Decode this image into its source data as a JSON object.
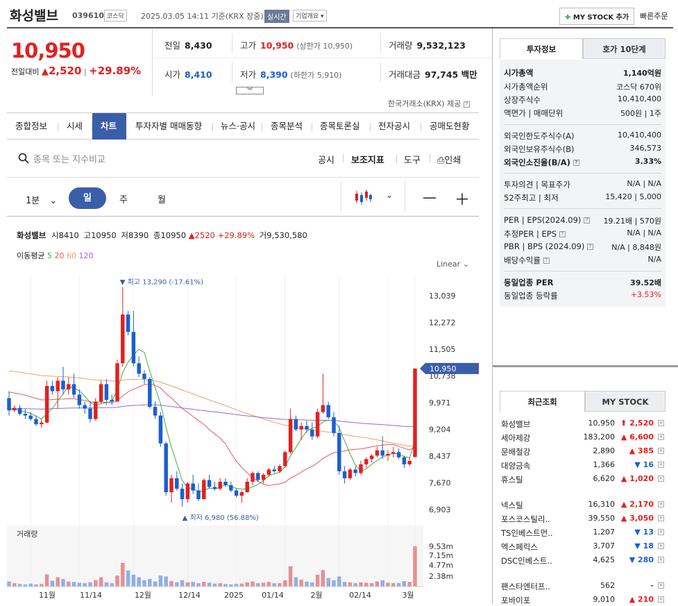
{
  "header": {
    "stock_name": "화성밸브",
    "stock_code": "039610",
    "market": "코스닥",
    "datetime": "2025.03.05 14:11 기준(KRX 장중)",
    "realtime_badge": "실시간",
    "corp_overview": "기업개요",
    "mystock_button": "MY STOCK 추가",
    "quick_order": "빠른주문"
  },
  "quote": {
    "price": "10,950",
    "change_label": "전일대비",
    "change_amount": "2,520",
    "change_pct": "+29.89%",
    "prev_label": "전일",
    "prev_value": "8,430",
    "high_label": "고가",
    "high_value": "10,950",
    "upper_limit": "(상한가 10,950)",
    "volume_label": "거래량",
    "volume_value": "9,532,123",
    "open_label": "시가",
    "open_value": "8,410",
    "low_label": "저가",
    "low_value": "8,390",
    "lower_limit": "(하한가 5,910)",
    "amount_label": "거래대금",
    "amount_value": "97,745 백만",
    "source_note": "한국거래소(KRX) 제공"
  },
  "tabs": [
    "종합정보",
    "시세",
    "차트",
    "투자자별 매매동향",
    "뉴스·공시",
    "종목분석",
    "종목토론실",
    "전자공시",
    "공매도현황"
  ],
  "active_tab": "차트",
  "toolbar": {
    "search_placeholder": "종목 또는 지수비교",
    "disclosure": "공시",
    "indicators": "보조지표",
    "tools": "도구",
    "print": "인쇄"
  },
  "period": {
    "interval": "1분",
    "day": "일",
    "week": "주",
    "month": "월"
  },
  "chart_info": {
    "name": "화성밸브",
    "open_lbl": "시",
    "open": "8410",
    "high_lbl": "고",
    "high": "10950",
    "low_lbl": "저",
    "low": "8390",
    "close_lbl": "종",
    "close": "10950",
    "chg": "▲2520",
    "chg_pct": "+29.89%",
    "vol_lbl": "거",
    "vol": "9,530,580",
    "ma_label": "이동평균",
    "ma5": "5",
    "ma20": "20",
    "ma60": "60",
    "ma120": "120",
    "scale": "Linear"
  },
  "chart_data": {
    "type": "candlestick",
    "y_ticks": [
      "13,039",
      "12,272",
      "11,505",
      "10,738",
      "9,971",
      "9,204",
      "8,437",
      "7,670",
      "6,903"
    ],
    "current_price_label": "10,950",
    "max_annotation": "▼ 최고 13,290 (-17.61%)",
    "min_annotation": "▲ 최저 6,980 (56.88%)",
    "volume_title": "거래량",
    "volume_ticks": [
      "9.53m",
      "7.15m",
      "4.77m",
      "2.38m"
    ],
    "x_ticks": [
      "11월",
      "11/14",
      "12월",
      "12/14",
      "2025",
      "01/14",
      "2월",
      "02/14",
      "3월"
    ],
    "colors": {
      "up": "#e32020",
      "down": "#1a5fd1",
      "ma5": "#3fae49",
      "ma20": "#e8585a",
      "ma60": "#f0a060",
      "ma120": "#9966dd"
    },
    "candles": [
      [
        10100,
        10300,
        9600,
        9750
      ],
      [
        9750,
        9900,
        9700,
        9820
      ],
      [
        9820,
        9900,
        9600,
        9650
      ],
      [
        9650,
        9800,
        9500,
        9600
      ],
      [
        9600,
        9700,
        9450,
        9500
      ],
      [
        9500,
        9600,
        9300,
        9350
      ],
      [
        9350,
        9500,
        9250,
        9400
      ],
      [
        9400,
        10600,
        9380,
        10450
      ],
      [
        10450,
        10600,
        10200,
        10300
      ],
      [
        10300,
        10700,
        9800,
        10600
      ],
      [
        10600,
        11000,
        10200,
        10350
      ],
      [
        10350,
        10700,
        10200,
        10500
      ],
      [
        10500,
        10800,
        10100,
        10200
      ],
      [
        10200,
        10350,
        9800,
        9900
      ],
      [
        9900,
        10000,
        9650,
        9800
      ],
      [
        9800,
        10000,
        9400,
        9500
      ],
      [
        9500,
        10100,
        9450,
        10000
      ],
      [
        10000,
        10600,
        9950,
        10500
      ],
      [
        10500,
        10650,
        9900,
        10050
      ],
      [
        10050,
        10200,
        9900,
        10000
      ],
      [
        10000,
        11200,
        10000,
        11100
      ],
      [
        11100,
        13290,
        11000,
        12500
      ],
      [
        12500,
        12600,
        11900,
        12000
      ],
      [
        12000,
        12600,
        11000,
        11100
      ],
      [
        11100,
        11300,
        10700,
        10800
      ],
      [
        10800,
        10900,
        10500,
        10650
      ],
      [
        10650,
        10700,
        9800,
        9850
      ],
      [
        9850,
        10000,
        9500,
        9600
      ],
      [
        9600,
        9700,
        8700,
        8800
      ],
      [
        8800,
        8850,
        7300,
        7400
      ],
      [
        7400,
        7900,
        7100,
        7800
      ],
      [
        7800,
        8000,
        7450,
        7500
      ],
      [
        7500,
        7650,
        6980,
        7200
      ],
      [
        7200,
        7700,
        7100,
        7650
      ],
      [
        7650,
        7900,
        7350,
        7450
      ],
      [
        7450,
        7650,
        7150,
        7200
      ],
      [
        7200,
        7800,
        7200,
        7750
      ],
      [
        7750,
        7900,
        7500,
        7550
      ],
      [
        7550,
        7700,
        7450,
        7500
      ],
      [
        7500,
        7800,
        7450,
        7700
      ],
      [
        7700,
        7800,
        7550,
        7600
      ],
      [
        7600,
        7700,
        7400,
        7450
      ],
      [
        7450,
        7500,
        7250,
        7300
      ],
      [
        7300,
        7450,
        7100,
        7400
      ],
      [
        7400,
        7800,
        7380,
        7700
      ],
      [
        7700,
        8000,
        7600,
        7950
      ],
      [
        7950,
        8000,
        7700,
        7750
      ],
      [
        7750,
        7950,
        7650,
        7900
      ],
      [
        7900,
        8100,
        7850,
        8050
      ],
      [
        8050,
        8150,
        7950,
        8000
      ],
      [
        8000,
        8200,
        7950,
        8150
      ],
      [
        8150,
        8600,
        8100,
        8550
      ],
      [
        8550,
        9800,
        8500,
        9500
      ],
      [
        9500,
        9600,
        9150,
        9200
      ],
      [
        9200,
        9400,
        8900,
        9300
      ],
      [
        9300,
        9450,
        9100,
        9200
      ],
      [
        9200,
        9400,
        8900,
        9000
      ],
      [
        9000,
        9800,
        8950,
        9700
      ],
      [
        9700,
        10800,
        9650,
        9900
      ],
      [
        9900,
        10000,
        9500,
        9550
      ],
      [
        9550,
        9700,
        9000,
        9100
      ],
      [
        9100,
        9300,
        7900,
        8000
      ],
      [
        8000,
        8150,
        7650,
        7800
      ],
      [
        7800,
        8100,
        7750,
        8050
      ],
      [
        8050,
        8150,
        7850,
        7950
      ],
      [
        7950,
        8300,
        7900,
        8200
      ],
      [
        8200,
        8400,
        8100,
        8350
      ],
      [
        8350,
        8500,
        8250,
        8450
      ],
      [
        8450,
        8700,
        8400,
        8600
      ],
      [
        8600,
        9000,
        8350,
        8450
      ],
      [
        8450,
        8600,
        8300,
        8500
      ],
      [
        8500,
        8700,
        8400,
        8550
      ],
      [
        8550,
        8650,
        8350,
        8400
      ],
      [
        8400,
        8450,
        8100,
        8200
      ],
      [
        8200,
        8400,
        8150,
        8300
      ],
      [
        8410,
        10950,
        8390,
        10950
      ]
    ],
    "volumes": [
      1.2,
      0.8,
      0.6,
      0.5,
      0.7,
      0.5,
      0.6,
      2.9,
      1.4,
      2.2,
      1.8,
      1.2,
      1.1,
      0.9,
      0.8,
      1.0,
      1.5,
      2.2,
      1.0,
      0.8,
      2.6,
      5.6,
      3.8,
      2.8,
      2.2,
      1.5,
      1.8,
      1.2,
      2.6,
      2.4,
      1.3,
      1.0,
      1.5,
      1.0,
      1.1,
      0.8,
      1.1,
      0.9,
      0.7,
      0.8,
      0.6,
      0.5,
      0.6,
      0.7,
      1.0,
      1.2,
      0.8,
      0.9,
      1.1,
      0.8,
      0.8,
      1.5,
      4.8,
      2.2,
      1.6,
      1.2,
      1.0,
      2.8,
      3.9,
      2.0,
      1.5,
      2.4,
      1.1,
      1.0,
      0.8,
      1.0,
      0.9,
      0.8,
      1.2,
      1.5,
      0.9,
      0.8,
      0.8,
      1.3,
      1.1,
      9.53
    ]
  },
  "right_panel": {
    "tab_invest": "투자정보",
    "tab_hoga": "호가 10단계",
    "rows": [
      {
        "label": "시가총액",
        "value": "1,140억원"
      },
      {
        "label": "시가총액순위",
        "value": "코스닥 670위"
      },
      {
        "label": "상장주식수",
        "value": "10,410,400"
      },
      {
        "label": "액면가 | 매매단위",
        "value": "500원 | 1주"
      },
      {
        "label": "외국인한도주식수(A)",
        "value": "10,410,400"
      },
      {
        "label": "외국인보유주식수(B)",
        "value": "346,573"
      },
      {
        "label": "외국인소진율(B/A)",
        "value": "3.33%"
      },
      {
        "label": "투자의견 | 목표주가",
        "value": "N/A | N/A"
      },
      {
        "label": "52주최고 | 최저",
        "value": "15,420 | 5,000"
      },
      {
        "label": "PER | EPS(2024.09)",
        "value": "19.21배 | 570원"
      },
      {
        "label": "추정PER | EPS",
        "value": "N/A | N/A"
      },
      {
        "label": "PBR | BPS (2024.09)",
        "value": "N/A | 8,848원"
      },
      {
        "label": "배당수익률",
        "value": "N/A"
      },
      {
        "label": "동일업종 PER",
        "value": "39.52배"
      },
      {
        "label": "동일업종 등락률",
        "value": "+3.53%"
      }
    ],
    "tab_recent": "최근조회",
    "tab_mystock": "MY STOCK",
    "recent": [
      {
        "name": "화성밸브",
        "price": "10,950",
        "chg": "2,520",
        "dir": "upper"
      },
      {
        "name": "세아제강",
        "price": "183,200",
        "chg": "6,600",
        "dir": "up"
      },
      {
        "name": "문배철강",
        "price": "2,890",
        "chg": "385",
        "dir": "up"
      },
      {
        "name": "대양금속",
        "price": "1,366",
        "chg": "16",
        "dir": "down"
      },
      {
        "name": "휴스틸",
        "price": "6,620",
        "chg": "1,020",
        "dir": "up"
      },
      {
        "name": "넥스틸",
        "price": "16,310",
        "chg": "2,170",
        "dir": "up"
      },
      {
        "name": "포스코스틸리..",
        "price": "39,550",
        "chg": "3,050",
        "dir": "up"
      },
      {
        "name": "TS인베스트먼..",
        "price": "1,207",
        "chg": "13",
        "dir": "down"
      },
      {
        "name": "엑스페릭스",
        "price": "3,707",
        "chg": "18",
        "dir": "down"
      },
      {
        "name": "DSC인베스트..",
        "price": "4,625",
        "chg": "280",
        "dir": "down"
      },
      {
        "name": "팬스타엔터프..",
        "price": "562",
        "chg": "-",
        "dir": "flat"
      },
      {
        "name": "포바이포",
        "price": "9,010",
        "chg": "210",
        "dir": "up"
      }
    ]
  }
}
